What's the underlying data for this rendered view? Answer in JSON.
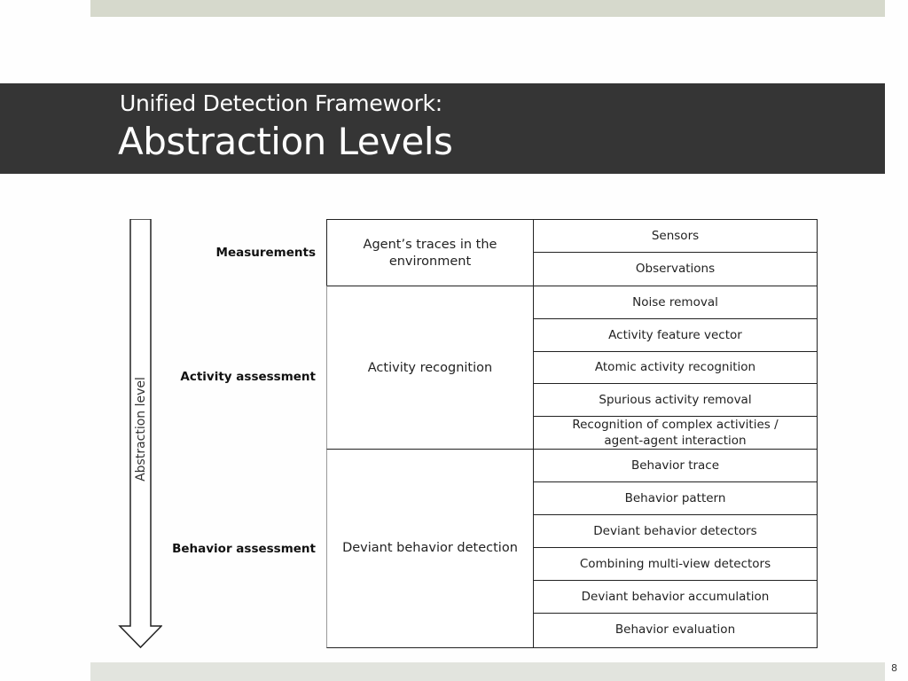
{
  "slide": {
    "title_line1": "Unified Detection Framework:",
    "title_line2": "Abstraction Levels",
    "page_number": "8"
  },
  "axis": {
    "label": "Abstraction level",
    "direction": "down"
  },
  "levels": [
    {
      "name": "Measurements",
      "process": "Agent’s traces in the environment",
      "steps": [
        "Sensors",
        "Observations"
      ]
    },
    {
      "name": "Activity assessment",
      "process": "Activity recognition",
      "steps": [
        "Noise removal",
        "Activity feature vector",
        "Atomic activity recognition",
        "Spurious activity removal",
        "Recognition of complex activities / agent-agent interaction"
      ]
    },
    {
      "name": "Behavior assessment",
      "process": "Deviant behavior detection",
      "steps": [
        "Behavior trace",
        "Behavior pattern",
        "Deviant behavior detectors",
        "Combining multi-view detectors",
        "Deviant behavior accumulation",
        "Behavior evaluation"
      ]
    }
  ]
}
